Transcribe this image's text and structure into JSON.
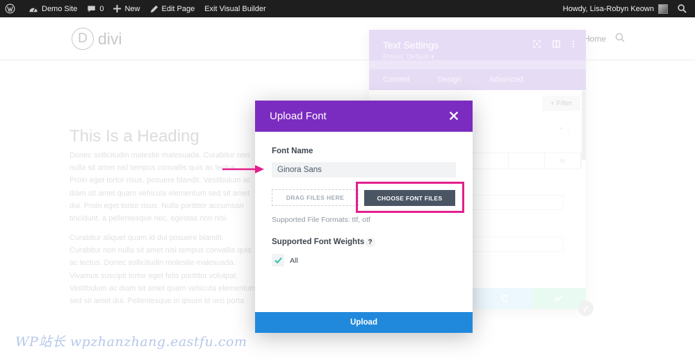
{
  "adminbar": {
    "site_name": "Demo Site",
    "comments_count": "0",
    "new_label": "New",
    "edit_page_label": "Edit Page",
    "exit_builder_label": "Exit Visual Builder",
    "greeting": "Howdy, Lisa-Robyn Keown"
  },
  "site": {
    "logo_letter": "D",
    "logo_text": "divi",
    "nav_home": "Home"
  },
  "page": {
    "heading": "This Is a Heading",
    "paragraph1": "Donec sollicitudin molestie malesuada. Curabitur non nulla sit amet nisl tempus convallis quis ac lectus. Proin eget tortor risus. posuere blandit. Vestibulum ac diam sit amet quam vehicula elementum sed sit amet dui. Proin eget tortor risus. Nulla porttitor accumsan tincidunt. a pellentesque nec, egestas non nisi. Vivamus magna justo, lacinia eget consectetur sed, pellentesque nec, egestas non nisi. Donec rutrum congue leo eget malesuada. porttitor volutpat.",
    "paragraph2": "Curabitur aliquet quam id dui posuere blandit. Curabitur non nulla sit amet nisl tempus convallis quis ac lectus. Donec sollicitudin molestie malesuada. Vivamus suscipit tortor eget felis porttitor volutpat. Vestibulum ac diam sit amet quam vehicula elementum sed sit amet dui. Pellentesque in ipsum id orci porta dapibus. Vivamus suscipit tortor eget felis porttitor volutpat."
  },
  "settings_panel": {
    "title": "Text Settings",
    "preset": "Preset: Default ▾",
    "tabs": [
      "Content",
      "Design",
      "Advanced"
    ],
    "filter_label": "Filter",
    "segment_options": [
      "",
      "",
      "M"
    ]
  },
  "modal": {
    "title": "Upload Font",
    "font_name_label": "Font Name",
    "font_name_value": "Ginora Sans",
    "drop_zone_label": "DRAG FILES HERE",
    "choose_button_label": "CHOOSE FONT FILES",
    "supported_formats": "Supported File Formats: ttf, otf",
    "weights_label": "Supported Font Weights",
    "help_glyph": "?",
    "weight_option_all": "All",
    "weight_all_checked": true,
    "upload_button_label": "Upload"
  },
  "watermark": "WP站长  wpzhanzhang.eastfu.com",
  "colors": {
    "adminbar_bg": "#1e1e1e",
    "modal_header": "#7b2cc0",
    "upload_button": "#2189dc",
    "choose_button": "#4a5564",
    "annotation": "#e31e8d",
    "check": "#29c4a9"
  }
}
